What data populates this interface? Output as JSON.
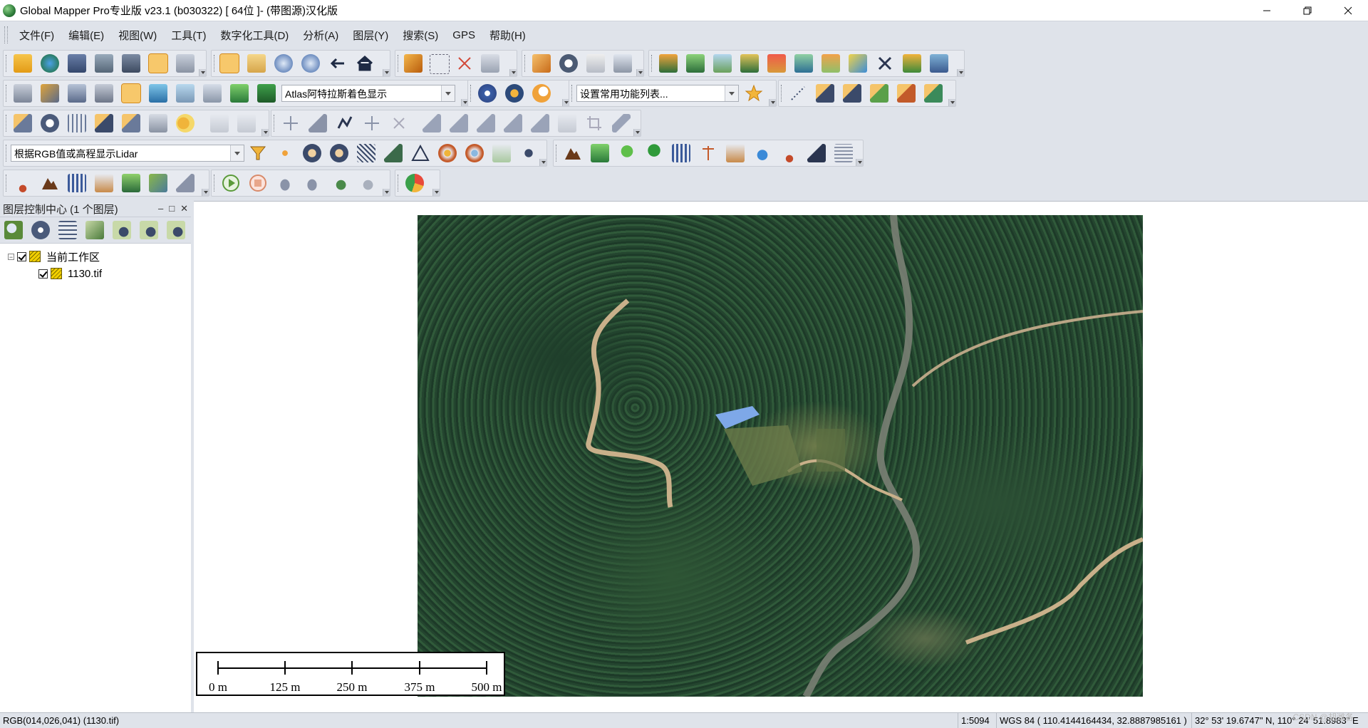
{
  "window": {
    "title": "Global Mapper Pro专业版 v23.1 (b030322) [ 64位 ]-   (带图源)汉化版"
  },
  "menu": {
    "items": [
      {
        "label": "文件(F)"
      },
      {
        "label": "编辑(E)"
      },
      {
        "label": "视图(W)"
      },
      {
        "label": "工具(T)"
      },
      {
        "label": "数字化工具(D)"
      },
      {
        "label": "分析(A)"
      },
      {
        "label": "图层(Y)"
      },
      {
        "label": "搜索(S)"
      },
      {
        "label": "GPS"
      },
      {
        "label": "帮助(H)"
      }
    ]
  },
  "toolbar": {
    "shader_combo": "Atlas阿特拉斯着色显示",
    "favorites_combo": "设置常用功能列表...",
    "lidar_combo": "根据RGB值或高程显示Lidar"
  },
  "layer_panel": {
    "title": "图层控制中心 (1 个图层)",
    "tree": [
      {
        "label": "当前工作区",
        "checked": true
      },
      {
        "label": "1130.tif",
        "checked": true
      }
    ]
  },
  "scalebar": {
    "labels": [
      "0 m",
      "125 m",
      "250 m",
      "375 m",
      "500 m"
    ]
  },
  "status": {
    "pixel_info": "RGB(014,026,041) (1130.tif)",
    "scale": "1:5094",
    "coords": "WGS 84 ( 110.4144164434, 32.8887985161 )",
    "dms": "32° 53' 19.6747\" N, 110° 24' 51.8983\" E",
    "watermark": "CSDN @胡潍各"
  },
  "colors": {
    "chrome": "#dfe3ea",
    "active_tool": "#f7c86b"
  }
}
